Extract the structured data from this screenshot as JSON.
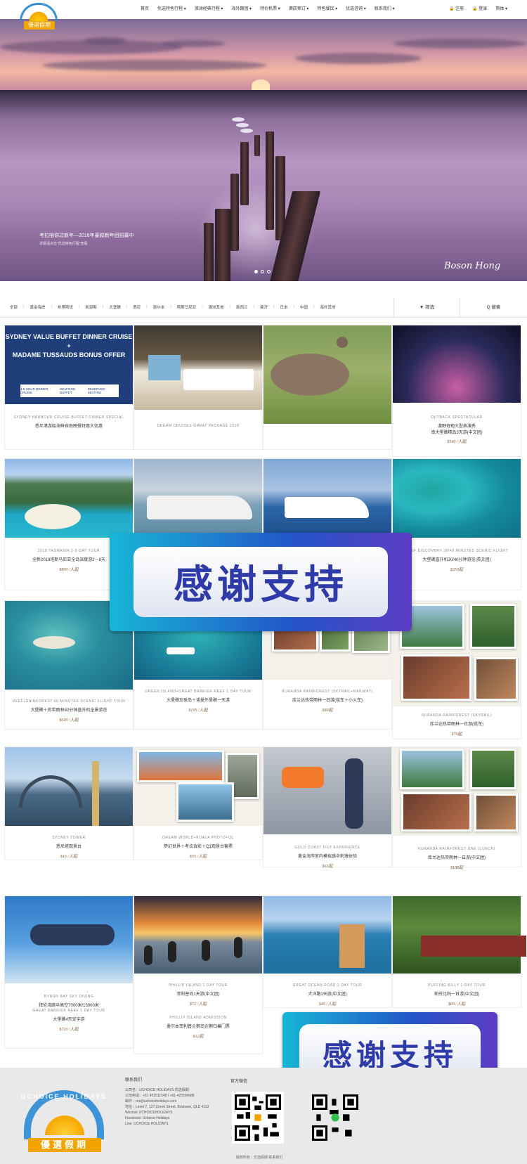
{
  "header": {
    "logo_text": "優選假期",
    "nav": [
      "首页",
      "优选特色行程 ▾",
      "澳洲经典行程 ▾",
      "海外跟团 ▾",
      "特价机票 ▾",
      "酒店预订 ▾",
      "特色餐饮 ▾",
      "优选咨询 ▾",
      "联系我们 ▾"
    ],
    "login": "🔒 注册",
    "register": "🔒 登录",
    "lang": "简体 ▾"
  },
  "hero": {
    "caption": "考拉陪你过新年—2018年豪叙新年团招募中",
    "sub": "详情请点击\"优选特色行程\"查看",
    "signature": "Boson Hong",
    "slides": 3,
    "active_slide": 0
  },
  "filter": {
    "categories": [
      "全部",
      "黄金海岸",
      "布里斯班",
      "凯恩斯",
      "大堡礁",
      "悉尼",
      "墨尔本",
      "塔斯马尼亚",
      "澳洲其他",
      "新西兰",
      "斐济",
      "日本",
      "中国",
      "海外其他"
    ],
    "filter_label": "▼ 筛选",
    "search_label": "Q 搜索"
  },
  "products": [
    {
      "sub": "SYDNEY HARBOUR CRUISE BUFFET DINNER SPECIAL",
      "title": "悉尼港游船海鲜自助晚餐特惠大优惠",
      "price": "",
      "banner": [
        "SYDNEY VALUE BUFFET DINNER CRUISE",
        "+",
        "MADAME TUSSAUDS BONUS OFFER"
      ],
      "badges": [
        "1.5 HOUR DINNER CRUISE",
        "SEAFOOD BUFFET",
        "RESERVED SEATING"
      ]
    },
    {
      "sub": "DREAM CRUISES GREAT PACKAGE 2018",
      "title": "",
      "price": ""
    },
    {
      "sub": "",
      "title": "",
      "price": ""
    },
    {
      "sub": "OUTBACK SPECTACULAR",
      "title": "澳野奇观大型表演秀",
      "title2": "南大堡礁精品3天游(中文团)",
      "price": "$549 /人起"
    },
    {
      "sub": "2018 TASMANIA 2-9 DAY TOUR",
      "title": "全新2018塔斯马尼亚全岛深度游2－9天",
      "price": "$800 /人起"
    },
    {
      "sub": "",
      "title": "",
      "price": ""
    },
    {
      "sub": "",
      "title": "",
      "price": ""
    },
    {
      "sub": "REEF DISCOVERY 30/40 MINUTES SCENIC FLIGHT",
      "title": "大堡礁直升机30/40分钟游览(英文团)",
      "price": "$350起"
    },
    {
      "sub": "REEF+RAINFOREST 60 MINUTES SCENIC FLIGHT TOUR",
      "title": "大堡礁＋热带雨林60分钟直升机全景游览",
      "price": "$649 /人起"
    },
    {
      "sub": "GREEN ISLAND+GREAT BARRIER REEF 1 DAY TOUR",
      "title": "大堡礁珍珠岛＋诺曼外堡礁一天游",
      "price": "$135 /人起"
    },
    {
      "sub": "KURANDA RAINFOREST (SKYRAIL+RAILWAY)",
      "title": "库兰达热带雨林一日游(缆车＋小火车)",
      "price": "$80起"
    },
    {
      "sub": "KURANDA RAINFOREST (SKYRAIL)",
      "title": "库兰达热带雨林一日游(缆车)",
      "price": "$70起"
    },
    {
      "sub": "SYDNEY TOWER",
      "title": "悉尼塔观景台",
      "price": "$16 /人起"
    },
    {
      "sub": "DREAM WORLD+KOALA PHOTO+Q1",
      "title": "梦幻世界＋考拉合影＋Q1观景台套票",
      "price": "$55 /人起"
    },
    {
      "sub": "GOLD COAST IFLY EXPERIENCE",
      "title": "黄金海岸室内模拟跳伞刺激体验",
      "price": "$63起"
    },
    {
      "sub": "KURANDA RAINFOREST ONE (LUNCH)",
      "title": "库兰达热带雨林一日游(中文团)",
      "price": "$188起"
    },
    {
      "sub": "BYRON BAY SKY DIVING",
      "title": "拜伦湾跳伞高空7000米/15000米",
      "sub2": "GREAT BARRIER REEF 1 DAY TOUR",
      "title2": "大堡礁4天安宇游",
      "price": "$720 /人起"
    },
    {
      "sub": "PHILLIP ISLAND 1 DAY TOUR",
      "title": "菲利普岛1天游(中文团)",
      "price": "$72 /人起",
      "sub2": "PHILLIP ISLAND ADMISSION",
      "title2": "墨尔本菲利普企鹅岛企鹅归巢门票",
      "price2": "$12起"
    },
    {
      "sub": "GREAT OCEAN ROAD 1 DAY TOUR",
      "title": "大洋路1天游(中文团)",
      "price": "$45 /人起"
    },
    {
      "sub": "PUFFING BILLY 1 DAY TOUR",
      "title": "帕芬比利一日游(中文团)",
      "price": "$69 /人起"
    }
  ],
  "watermark": {
    "text": "感谢支持"
  },
  "footer": {
    "logo_arc": "UCHOICE HOLIDAYS",
    "logo_cn": "優選假期",
    "contact_heading": "联系我们",
    "contact_lines": [
      "公司名：UCHOICE HOLIDAYS 优选假期",
      "公司电话：+61 451511548 / +61 420500688",
      "邮件：res@uchoiceholidays.com",
      "地址：Level 7, 127 Creek Street, Brisbane, QLD 4113",
      "Wechat: UCHOICEHOLIDAYS",
      "Facebook: Uchoice Holidays",
      "Line: UCHOICE HOLIDAYS"
    ],
    "wechat_heading": "官方微信",
    "copyright": "版权所有：优选假期 联系我们"
  },
  "colors": {
    "accent": "#f2a400",
    "brand_blue": "#3d95d8",
    "watermark_text": "#2d3aa8"
  }
}
